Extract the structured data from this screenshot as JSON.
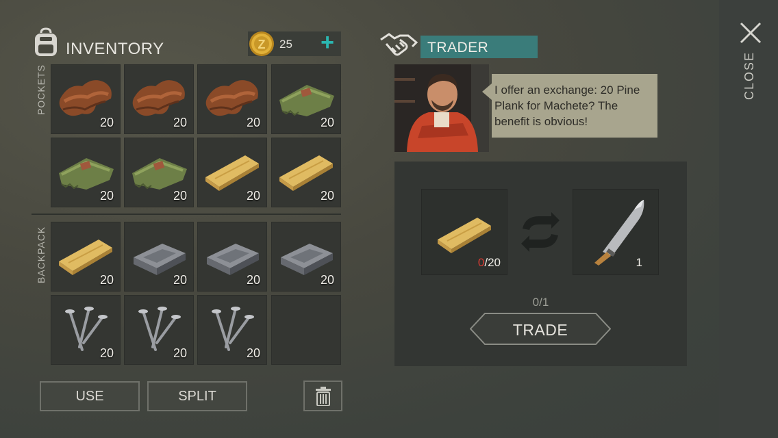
{
  "inventory": {
    "title": "INVENTORY",
    "coins": "25",
    "add_coins_label": "+",
    "pockets_label": "POCKETS",
    "backpack_label": "BACKPACK",
    "pockets": [
      {
        "item": "leather",
        "qty": "20"
      },
      {
        "item": "leather",
        "qty": "20"
      },
      {
        "item": "leather",
        "qty": "20"
      },
      {
        "item": "cloth",
        "qty": "20"
      },
      {
        "item": "cloth",
        "qty": "20"
      },
      {
        "item": "cloth",
        "qty": "20"
      },
      {
        "item": "pine-plank",
        "qty": "20"
      },
      {
        "item": "pine-plank",
        "qty": "20"
      }
    ],
    "backpack": [
      {
        "item": "pine-plank",
        "qty": "20"
      },
      {
        "item": "iron-ingot",
        "qty": "20"
      },
      {
        "item": "iron-ingot",
        "qty": "20"
      },
      {
        "item": "iron-ingot",
        "qty": "20"
      },
      {
        "item": "nails",
        "qty": "20"
      },
      {
        "item": "nails",
        "qty": "20"
      },
      {
        "item": "nails",
        "qty": "20"
      },
      {
        "item": "empty",
        "qty": ""
      }
    ]
  },
  "actions": {
    "use_label": "USE",
    "split_label": "SPLIT",
    "trash_icon": "trash-icon"
  },
  "trader": {
    "title": "TRADER",
    "message": "I offer an exchange: 20 Pine Plank for Machete? The benefit is obvious!",
    "give": {
      "item": "pine-plank",
      "have": "0",
      "need": "/20"
    },
    "get": {
      "item": "machete",
      "qty": "1"
    },
    "progress": "0/1",
    "trade_label": "TRADE"
  },
  "close_label": "CLOSE",
  "colors": {
    "accent_teal": "#3a7c7a",
    "plus_teal": "#2bb6b0",
    "missing_red": "#d83a32",
    "speech_bg": "#a8a58e"
  }
}
